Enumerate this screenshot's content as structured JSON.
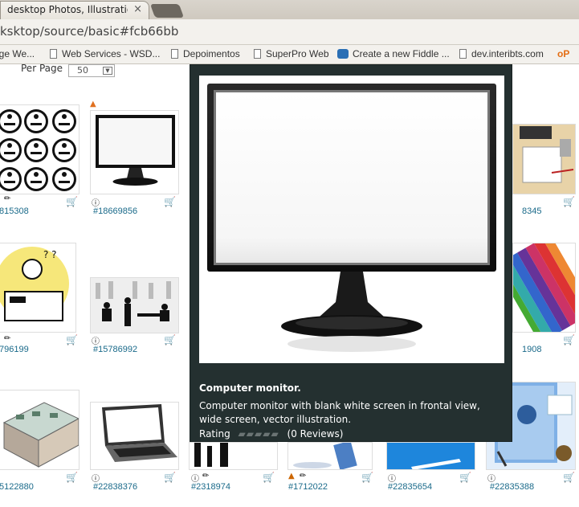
{
  "browser": {
    "tab_title": "desktop Photos, Illustratio",
    "tab_close": "×",
    "url": "ksktop/source/basic#fcb66bb",
    "bookmarks": [
      {
        "label": "ige We..."
      },
      {
        "label": "Web Services - WSD..."
      },
      {
        "label": "Depoimentos"
      },
      {
        "label": "SuperPro Web"
      },
      {
        "label": "Create a new Fiddle ..."
      },
      {
        "label": "dev.interibts.com"
      },
      {
        "label": "oP"
      }
    ]
  },
  "toolbar": {
    "per_page_label": "Per Page",
    "per_page_value": "50"
  },
  "items": [
    {
      "id": "815308"
    },
    {
      "id": "#18669856"
    },
    {
      "id": "8345"
    },
    {
      "id": "796199"
    },
    {
      "id": "#15786992"
    },
    {
      "id": "1908"
    },
    {
      "id": "5122880"
    },
    {
      "id": "#22838376"
    },
    {
      "id": "#2318974"
    },
    {
      "id": "#1712022"
    },
    {
      "id": "#22835654"
    },
    {
      "id": "#22835388"
    }
  ],
  "tooltip": {
    "title": "Computer monitor.",
    "description": "Computer monitor with blank white screen in frontal view, wide screen, vector illustration.",
    "rating_label": "Rating",
    "reviews": "(0 Reviews)"
  },
  "colors": {
    "tooltip_bg": "#243030",
    "link": "#1a6a8a"
  }
}
